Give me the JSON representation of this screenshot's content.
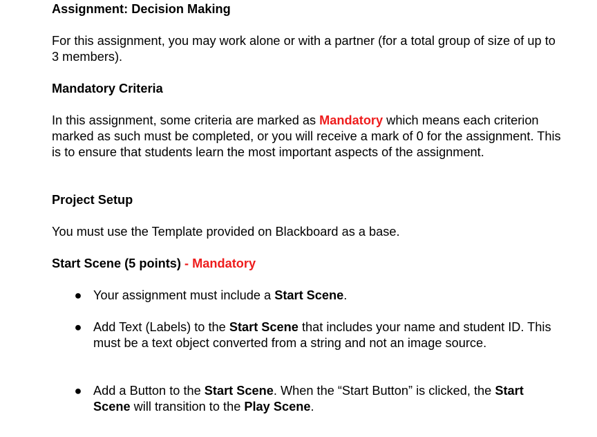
{
  "title": "Assignment: Decision Making",
  "intro": "For this assignment, you may work alone or with a partner (for a total group of size of up to 3 members).",
  "mandatory_heading": "Mandatory Criteria",
  "mandatory_para": {
    "before": "In this assignment, some criteria are marked as ",
    "keyword": "Mandatory",
    "after": " which means each criterion marked as such must be completed, or you will receive a mark of 0 for the assignment. This is to ensure that students learn the most important aspects of the assignment."
  },
  "setup_heading": "Project Setup",
  "setup_para": "You must use the Template provided on Blackboard as a base.",
  "start_scene_heading": {
    "label": "Start Scene (5 points)",
    "separator": " - ",
    "tag": "Mandatory"
  },
  "bullets": {
    "b1": {
      "text1": "Your assignment must include a ",
      "bold1": "Start Scene",
      "text2": "."
    },
    "b2": {
      "text1": "Add Text (Labels) to the ",
      "bold1": "Start Scene",
      "text2": " that includes your name and student ID. This must be a text object converted from a string and not an image source."
    },
    "b3": {
      "text1": "Add a Button to the ",
      "bold1": "Start Scene",
      "text2": ". When the “Start Button” is clicked, the ",
      "bold2": "Start Scene",
      "text3": " will transition to the ",
      "bold3": "Play Scene",
      "text4": "."
    }
  }
}
